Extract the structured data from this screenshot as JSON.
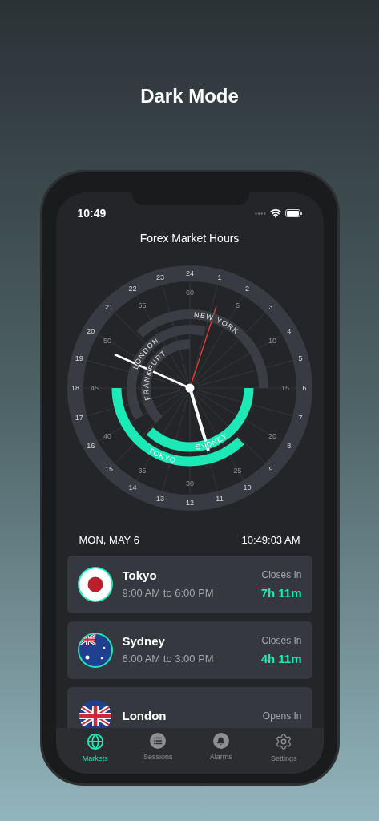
{
  "headline": "Dark Mode",
  "status_bar": {
    "time": "10:49"
  },
  "title": "Forex Market Hours",
  "dial": {
    "hour_labels": [
      "24",
      "1",
      "2",
      "3",
      "4",
      "5",
      "6",
      "7",
      "8",
      "9",
      "10",
      "11",
      "12",
      "13",
      "14",
      "15",
      "16",
      "17",
      "18",
      "19",
      "20",
      "21",
      "22",
      "23"
    ],
    "minute_labels": [
      "60",
      "5",
      "10",
      "15",
      "20",
      "25",
      "30",
      "35",
      "40",
      "45",
      "50",
      "55"
    ]
  },
  "sessions": [
    {
      "name": "NEW YORK",
      "open": false
    },
    {
      "name": "LONDON",
      "open": false
    },
    {
      "name": "FRANKFURT",
      "open": false
    },
    {
      "name": "SYDNEY",
      "open": true
    },
    {
      "name": "TOKYO",
      "open": true
    }
  ],
  "date": "MON, MAY 6",
  "clock": "10:49:03 AM",
  "markets": [
    {
      "name": "Tokyo",
      "hours": "9:00 AM to 6:00 PM",
      "status": "Closes In",
      "countdown": "7h 11m",
      "open": true,
      "kind": "japan"
    },
    {
      "name": "Sydney",
      "hours": "6:00 AM to 3:00 PM",
      "status": "Closes In",
      "countdown": "4h 11m",
      "open": true,
      "kind": "australia"
    },
    {
      "name": "London",
      "status": "Opens In",
      "open": false,
      "kind": "uk"
    }
  ],
  "tabs": [
    {
      "label": "Markets",
      "selected": true,
      "kind": "globe"
    },
    {
      "label": "Sessions",
      "selected": false,
      "kind": "list"
    },
    {
      "label": "Alarms",
      "selected": false,
      "kind": "bell"
    },
    {
      "label": "Settings",
      "selected": false,
      "kind": "gear"
    }
  ]
}
